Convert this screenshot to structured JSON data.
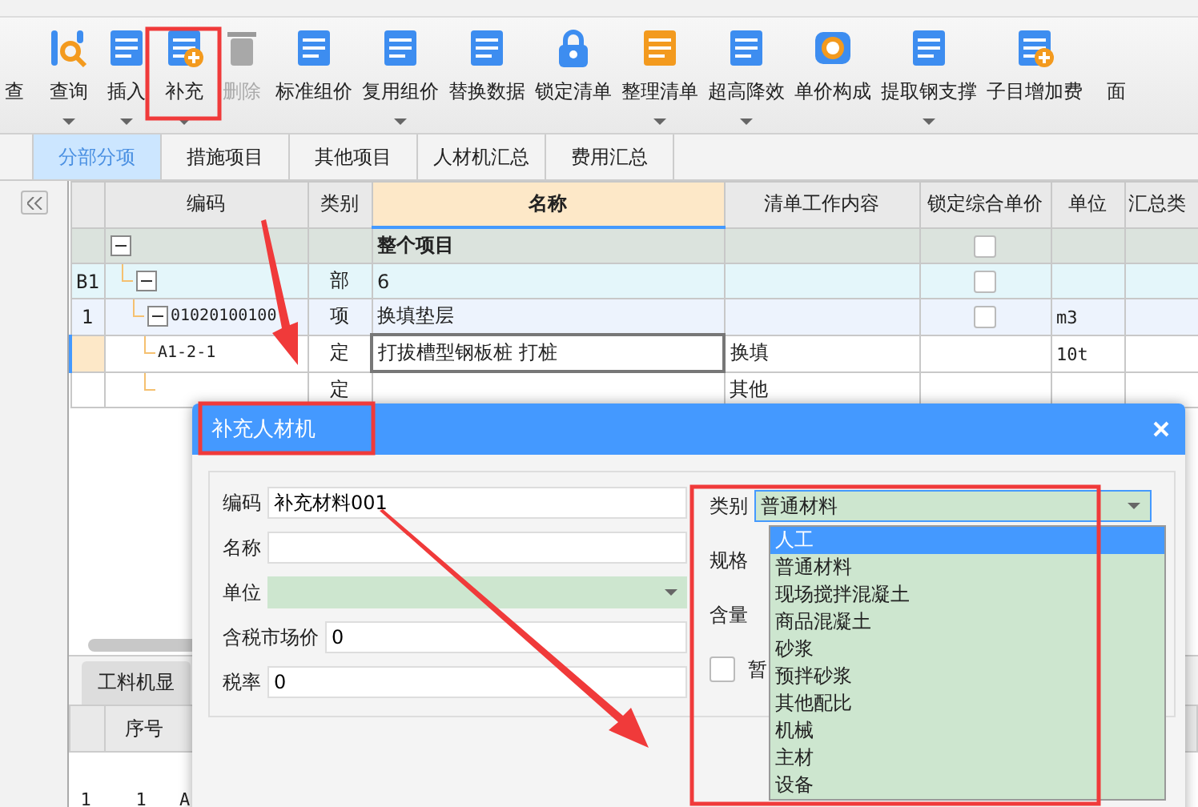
{
  "toolbar": [
    {
      "label": "查",
      "caret": false,
      "disabled": false
    },
    {
      "label": "查询",
      "caret": true,
      "disabled": false
    },
    {
      "label": "插入",
      "caret": true,
      "disabled": false
    },
    {
      "label": "补充",
      "caret": true,
      "disabled": false
    },
    {
      "label": "删除",
      "caret": false,
      "disabled": true
    },
    {
      "label": "标准组价",
      "caret": false,
      "disabled": false
    },
    {
      "label": "复用组价",
      "caret": true,
      "disabled": false
    },
    {
      "label": "替换数据",
      "caret": false,
      "disabled": false
    },
    {
      "label": "锁定清单",
      "caret": false,
      "disabled": false
    },
    {
      "label": "整理清单",
      "caret": true,
      "disabled": false
    },
    {
      "label": "超高降效",
      "caret": true,
      "disabled": false
    },
    {
      "label": "单价构成",
      "caret": false,
      "disabled": false
    },
    {
      "label": "提取钢支撑",
      "caret": true,
      "disabled": false
    },
    {
      "label": "子目增加费",
      "caret": false,
      "disabled": false
    },
    {
      "label": "面",
      "caret": false,
      "disabled": false
    }
  ],
  "tabs": [
    {
      "label": "分部分项",
      "selected": true
    },
    {
      "label": "措施项目",
      "selected": false
    },
    {
      "label": "其他项目",
      "selected": false
    },
    {
      "label": "人材机汇总",
      "selected": false
    },
    {
      "label": "费用汇总",
      "selected": false
    }
  ],
  "grid": {
    "columns": [
      "编码",
      "类别",
      "名称",
      "清单工作内容",
      "锁定综合单价",
      "单位",
      "汇总类"
    ],
    "rows": [
      {
        "name": "整个项目",
        "expanded": true,
        "checked": false,
        "children": [
          {
            "row_no": "B1",
            "category": "部",
            "name": "6",
            "expanded": true,
            "checked": false,
            "children": [
              {
                "row_no": "1",
                "code": "01020100100",
                "category": "项",
                "name": "换填垫层",
                "unit": "m3",
                "expanded": true,
                "checked": false,
                "children": [
                  {
                    "code": "A1-2-1",
                    "category": "定",
                    "name": "打拔槽型钢板桩 打桩",
                    "work_content": "换填",
                    "unit": "10t",
                    "selected": true
                  },
                  {
                    "category": "定",
                    "work_content": "其他",
                    "selected": false
                  }
                ]
              }
            ]
          }
        ]
      }
    ]
  },
  "lower_panel": {
    "tab": "工料机显",
    "columns": [
      "序号"
    ],
    "row": [
      "1",
      "1",
      "A"
    ]
  },
  "dialog": {
    "title": "补充人材机",
    "fields": [
      {
        "label": "编码",
        "kind": "text",
        "value": "补充材料001"
      },
      {
        "label": "名称",
        "kind": "text"
      },
      {
        "label": "单位",
        "kind": "select"
      },
      {
        "label": "含税市场价",
        "kind": "text",
        "value": "0"
      },
      {
        "label": "税率",
        "kind": "text",
        "value": "0"
      }
    ],
    "category": {
      "label": "类别",
      "value": "普通材料",
      "options": [
        {
          "label": "人工",
          "highlighted": true
        },
        {
          "label": "普通材料",
          "highlighted": false
        },
        {
          "label": "现场搅拌混凝土",
          "highlighted": false
        },
        {
          "label": "商品混凝土",
          "highlighted": false
        },
        {
          "label": "砂浆",
          "highlighted": false
        },
        {
          "label": "预拌砂浆",
          "highlighted": false
        },
        {
          "label": "其他配比",
          "highlighted": false
        },
        {
          "label": "机械",
          "highlighted": false
        },
        {
          "label": "主材",
          "highlighted": false
        },
        {
          "label": "设备",
          "highlighted": false
        }
      ]
    },
    "right_fields": [
      {
        "label": "规格"
      },
      {
        "label": "含量"
      }
    ],
    "checkbox": {
      "label": "暂",
      "checked": false
    }
  }
}
